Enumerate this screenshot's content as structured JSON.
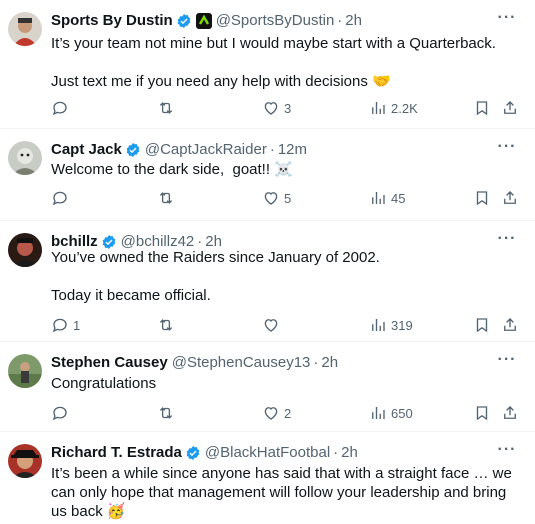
{
  "tweets": [
    {
      "name": "Sports By Dustin",
      "handle": "@SportsByDustin",
      "time": "2h",
      "text": "It’s your team not mine but I would maybe start with a Quarterback.\n\nJust text me if you need any help with decisions 🤝",
      "replies": "",
      "retweets": "",
      "likes": "3",
      "views": "2.2K"
    },
    {
      "name": "Capt Jack",
      "handle": "@CaptJackRaider",
      "time": "12m",
      "text": "Welcome to the dark side,  goat!! ☠️",
      "replies": "",
      "retweets": "",
      "likes": "5",
      "views": "45"
    },
    {
      "name": "bchillz",
      "handle": "@bchillz42",
      "time": "2h",
      "text": "You’ve owned the Raiders since January of 2002.\n\nToday it became official.",
      "replies": "1",
      "retweets": "",
      "likes": "",
      "views": "319"
    },
    {
      "name": "Stephen Causey",
      "handle": "@StephenCausey13",
      "time": "2h",
      "text": "Congratulations",
      "replies": "",
      "retweets": "",
      "likes": "2",
      "views": "650"
    },
    {
      "name": "Richard T. Estrada",
      "handle": "@BlackHatFootbal",
      "time": "2h",
      "text": "It’s been a while since anyone has said that with a straight face … we can only hope that management will follow your leadership and bring us back 🥳",
      "replies": "",
      "retweets": "",
      "likes": "",
      "views": ""
    }
  ],
  "separator": "·",
  "colors": {
    "verified": "#1d9bf0",
    "secondary_text": "#536471",
    "primary_text": "#0f1419"
  }
}
